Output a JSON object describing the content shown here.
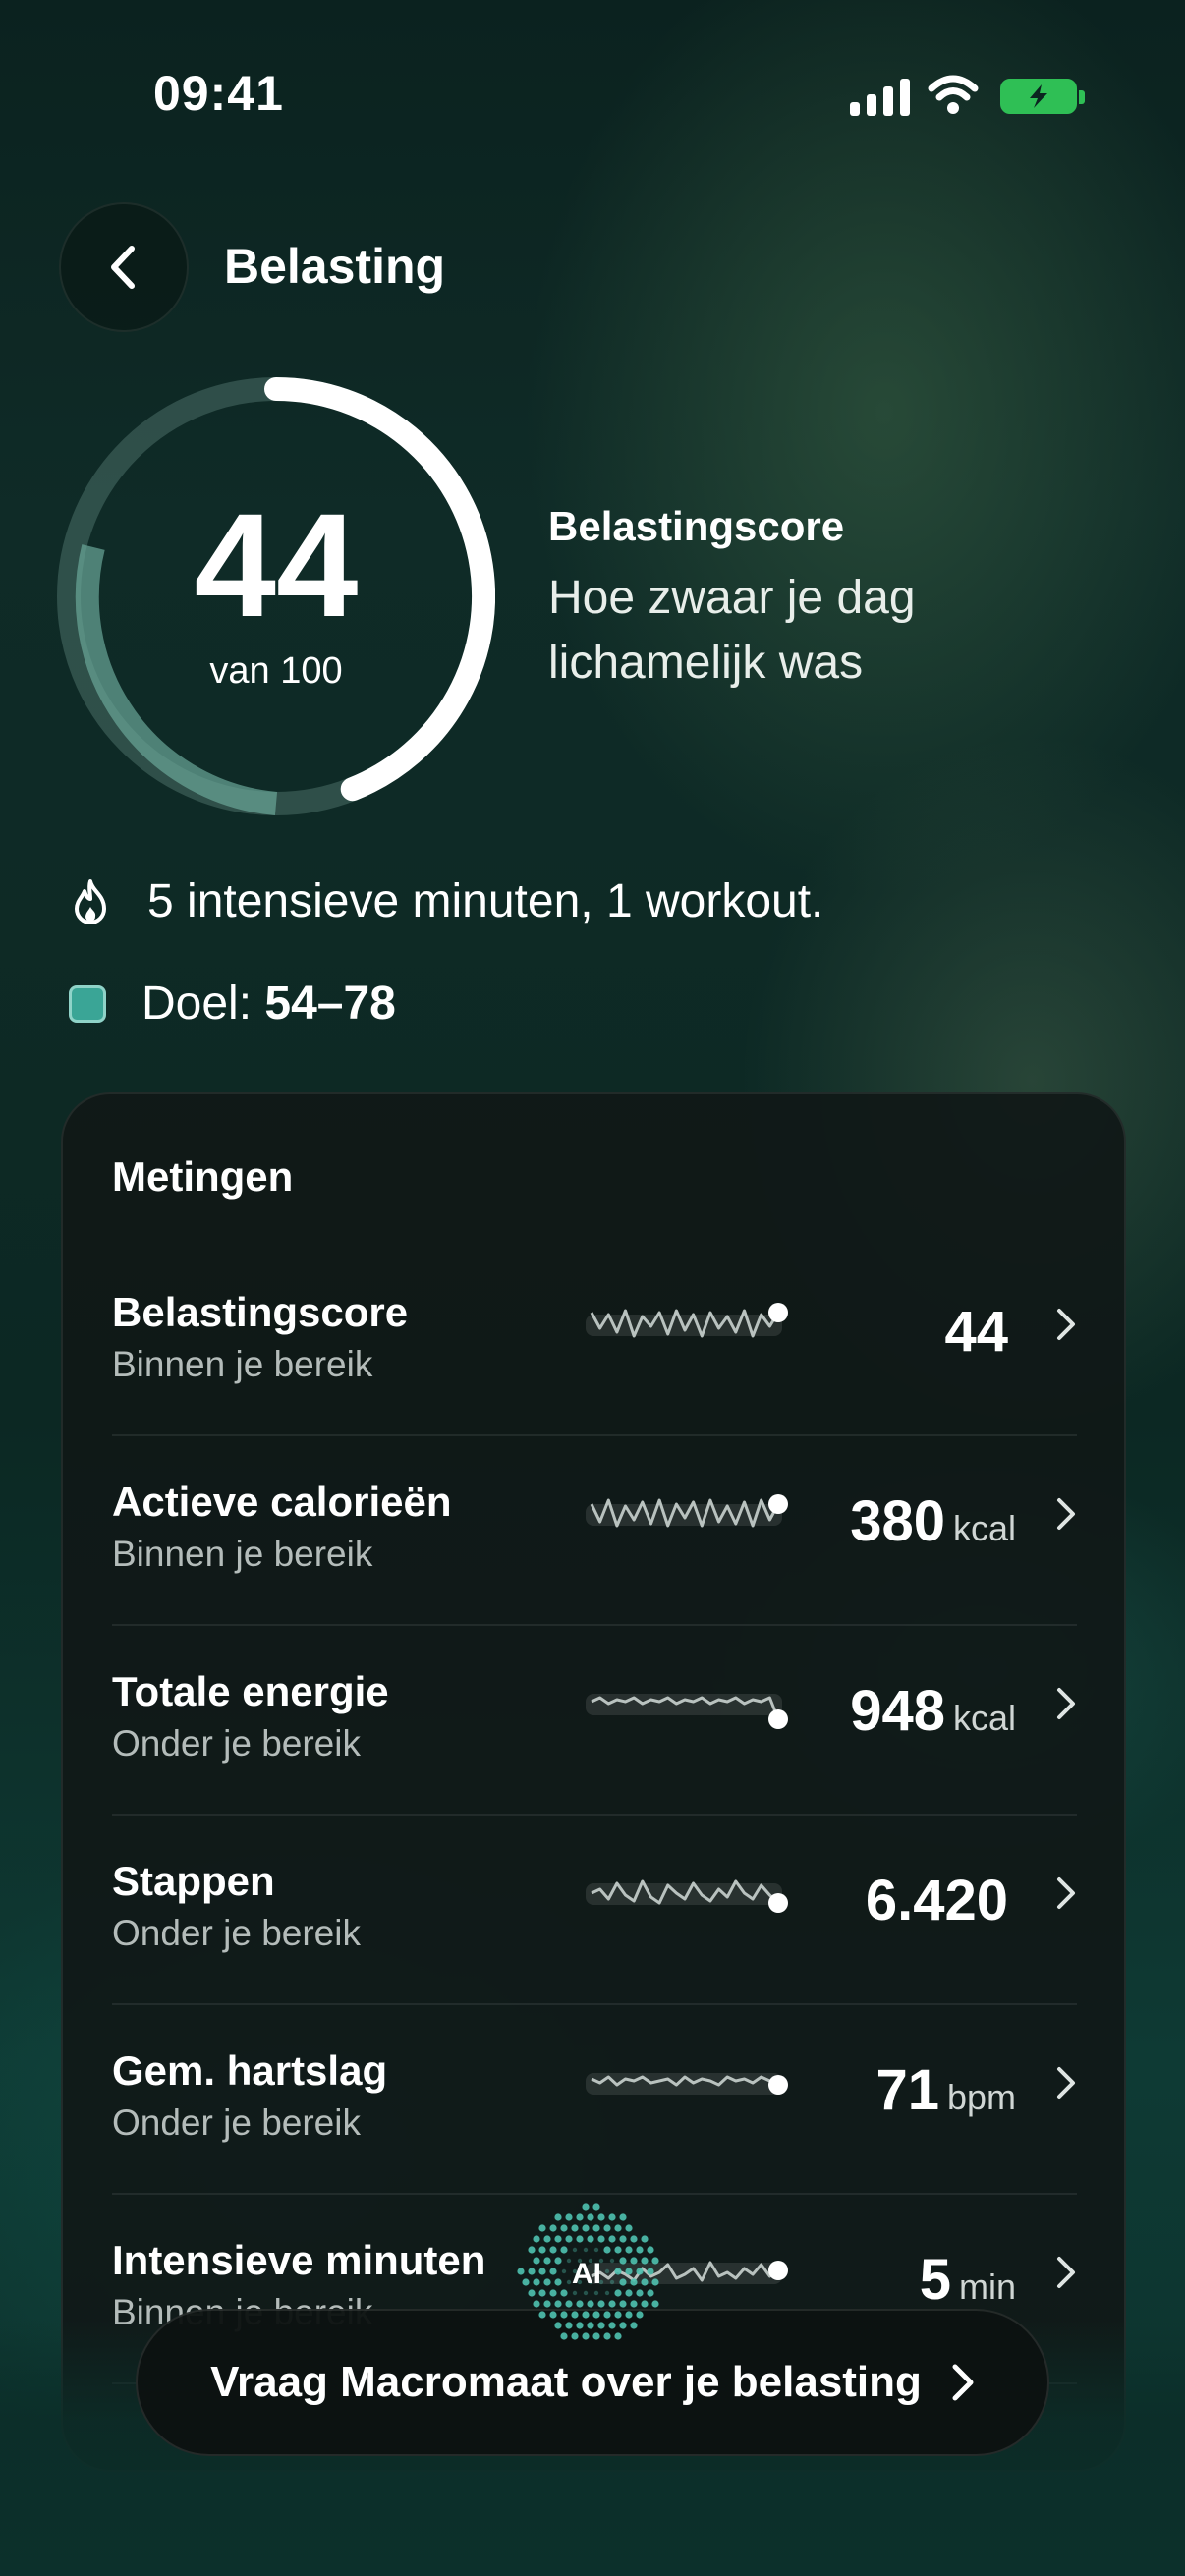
{
  "status_bar": {
    "time": "09:41"
  },
  "header": {
    "title": "Belasting"
  },
  "score": {
    "value": "44",
    "suffix": "van 100",
    "progress": 0.44,
    "label": "Belastingscore",
    "description": "Hoe zwaar je dag lichamelijk was"
  },
  "summary": {
    "intensity_text": "5 intensieve minuten, 1 workout.",
    "goal_prefix": "Doel: ",
    "goal_range": "54–78"
  },
  "metrics": {
    "title": "Metingen",
    "items": [
      {
        "name": "Belastingscore",
        "status": "Binnen je bereik",
        "value": "44",
        "unit": ""
      },
      {
        "name": "Actieve calorieën",
        "status": "Binnen je bereik",
        "value": "380",
        "unit": "kcal"
      },
      {
        "name": "Totale energie",
        "status": "Onder je bereik",
        "value": "948",
        "unit": "kcal"
      },
      {
        "name": "Stappen",
        "status": "Onder je bereik",
        "value": "6.420",
        "unit": ""
      },
      {
        "name": "Gem. hartslag",
        "status": "Onder je bereik",
        "value": "71",
        "unit": "bpm"
      },
      {
        "name": "Intensieve minuten",
        "status": "Binnen je bereik",
        "value": "5",
        "unit": "min"
      }
    ]
  },
  "cta": {
    "label": "Vraag Macromaat over je belasting",
    "badge": "AI"
  },
  "colors": {
    "accent": "#3aa596",
    "battery": "#2fbf55",
    "card": "#101817"
  }
}
